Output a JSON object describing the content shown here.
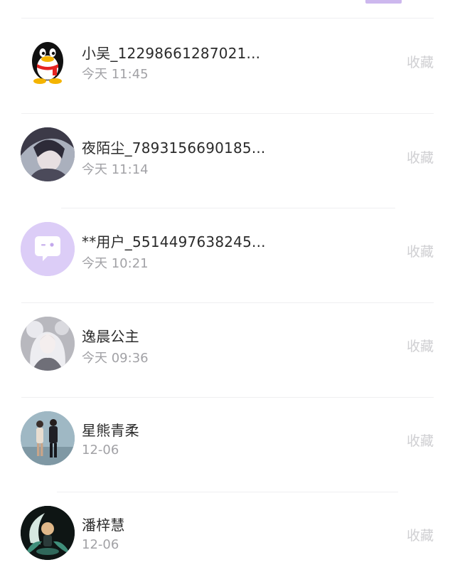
{
  "favorite_label": "收藏",
  "messages": [
    {
      "name": "小吴_12298661287021...",
      "time": "今天 11:45",
      "avatar_icon": "qq-penguin-icon"
    },
    {
      "name": "夜陌尘_7893156690185...",
      "time": "今天 11:14",
      "avatar_icon": "anime-portrait-icon"
    },
    {
      "name": "**用户_5514497638245...",
      "time": "今天 10:21",
      "avatar_icon": "default-chat-bubble-icon"
    },
    {
      "name": "逸晨公主",
      "time": "今天 09:36",
      "avatar_icon": "fantasy-girl-portrait-icon"
    },
    {
      "name": "星熊青柔",
      "time": "12-06",
      "avatar_icon": "couple-photo-icon"
    },
    {
      "name": "潘梓慧",
      "time": "12-06",
      "avatar_icon": "glowing-moon-character-icon"
    }
  ],
  "colors": {
    "accent": "#cdb8ee",
    "default_avatar_bg": "#dccdf7",
    "name_text": "#2b2b2b",
    "time_text": "#a2a2a6",
    "favorite_text": "#cfcfd2"
  }
}
